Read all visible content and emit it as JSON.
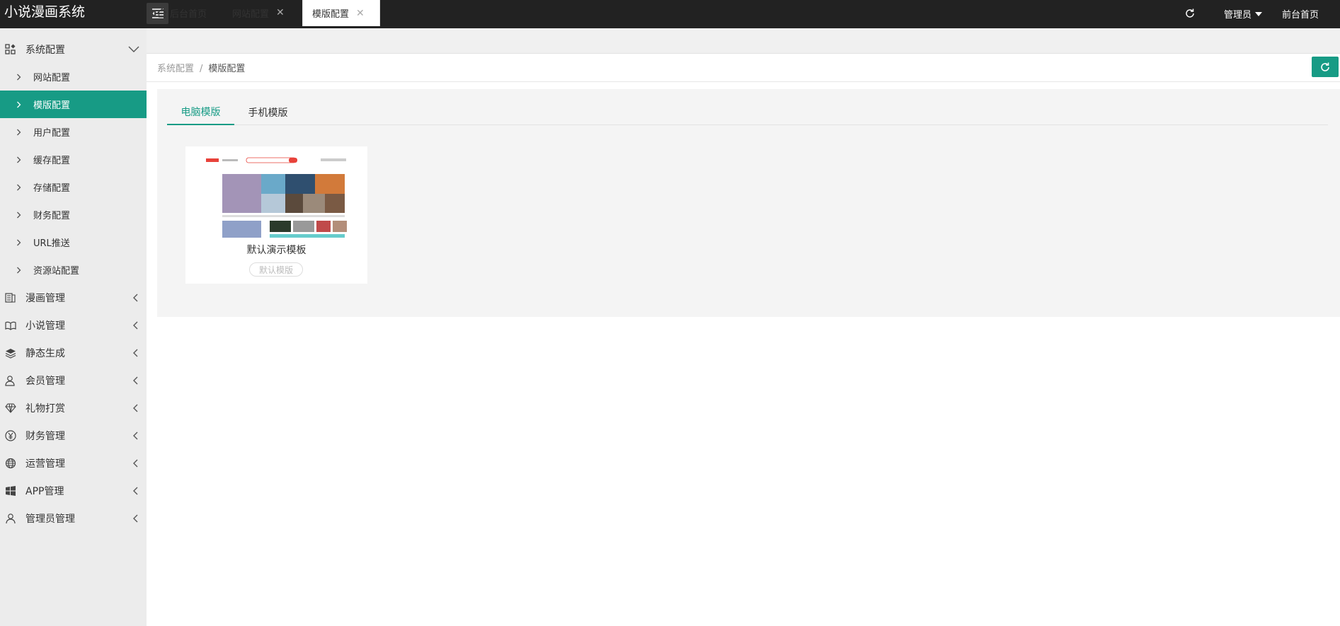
{
  "app": {
    "title": "小说漫画系统"
  },
  "header": {
    "admin_label": "管理员",
    "front_label": "前台首页"
  },
  "sidebar": {
    "groups": [
      {
        "label": "系统配置",
        "icon": "app-grid-icon",
        "expanded": true
      },
      {
        "label": "漫画管理",
        "icon": "comic-icon"
      },
      {
        "label": "小说管理",
        "icon": "book-open-icon"
      },
      {
        "label": "静态生成",
        "icon": "layers-icon"
      },
      {
        "label": "会员管理",
        "icon": "users-icon"
      },
      {
        "label": "礼物打赏",
        "icon": "diamond-icon"
      },
      {
        "label": "财务管理",
        "icon": "yen-circle-icon"
      },
      {
        "label": "运营管理",
        "icon": "globe-icon"
      },
      {
        "label": "APP管理",
        "icon": "windows-icon"
      },
      {
        "label": "管理员管理",
        "icon": "user-icon"
      }
    ],
    "sub_items": [
      {
        "label": "网站配置"
      },
      {
        "label": "模版配置",
        "active": true
      },
      {
        "label": "用户配置"
      },
      {
        "label": "缓存配置"
      },
      {
        "label": "存储配置"
      },
      {
        "label": "财务配置"
      },
      {
        "label": "URL推送"
      },
      {
        "label": "资源站配置"
      }
    ]
  },
  "tabs": [
    {
      "label": "后台首页",
      "icon": "home-icon"
    },
    {
      "label": "网站配置",
      "closable": true
    },
    {
      "label": "模版配置",
      "closable": true,
      "active": true
    }
  ],
  "breadcrumb": {
    "parent": "系统配置",
    "sep": "/",
    "current": "模版配置"
  },
  "template_tabs": [
    {
      "label": "电脑模版",
      "active": true
    },
    {
      "label": "手机模版"
    }
  ],
  "templates": [
    {
      "name": "默认演示模板",
      "badge": "默认模版"
    }
  ],
  "colors": {
    "accent": "#179b85",
    "header_bg": "#222222",
    "sidebar_bg": "#ececec"
  }
}
